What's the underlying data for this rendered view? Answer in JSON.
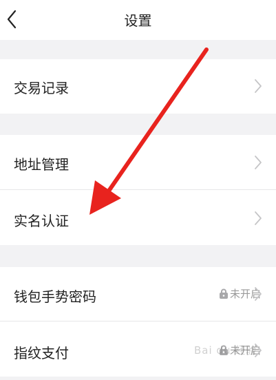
{
  "header": {
    "title": "设置",
    "back_icon": "chevron-left-icon"
  },
  "rows": [
    {
      "label": "交易记录"
    },
    {
      "label": "地址管理"
    },
    {
      "label": "实名认证"
    },
    {
      "label": "钱包手势密码",
      "status": "未开启"
    },
    {
      "label": "指纹支付",
      "status": "未开启"
    }
  ],
  "watermark": "Bai du 经验",
  "colors": {
    "arrow": "#e8231e",
    "background": "#f2f2f4",
    "row_background": "#ffffff",
    "chevron": "#c5c5c7",
    "status_text": "#999999"
  }
}
